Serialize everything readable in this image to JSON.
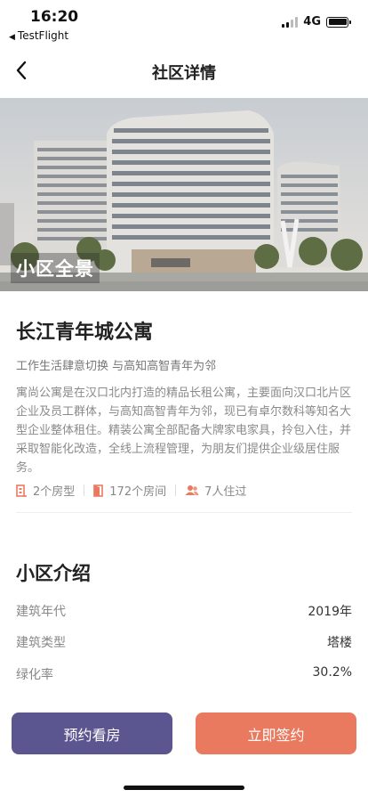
{
  "status": {
    "time": "16:20",
    "back_app": "TestFlight",
    "network": "4G"
  },
  "nav": {
    "title": "社区详情"
  },
  "hero": {
    "label": "小区全景"
  },
  "community": {
    "name": "长江青年城公寓",
    "slogan": "工作生活肆意切换 与高知高智青年为邻",
    "description": "寓尚公寓是在汉口北内打造的精品长租公寓，主要面向汉口北片区企业及员工群体，与高知高智青年为邻，现已有卓尔数科等知名大型企业整体租住。精装公寓全部配备大牌家电家具，拎包入住，并采取智能化改造，全线上流程管理，为朋友们提供企业级居住服务。",
    "stats": {
      "room_types": "2个房型",
      "rooms": "172个房间",
      "residents": "7人住过"
    }
  },
  "intro": {
    "title": "小区介绍",
    "rows": [
      {
        "key": "建筑年代",
        "value": "2019年"
      },
      {
        "key": "建筑类型",
        "value": "塔楼"
      },
      {
        "key": "绿化率",
        "value": "30.2%"
      }
    ]
  },
  "actions": {
    "view": "预约看房",
    "sign": "立即签约"
  },
  "colors": {
    "primary": "#5c5690",
    "accent": "#e97a5f"
  }
}
